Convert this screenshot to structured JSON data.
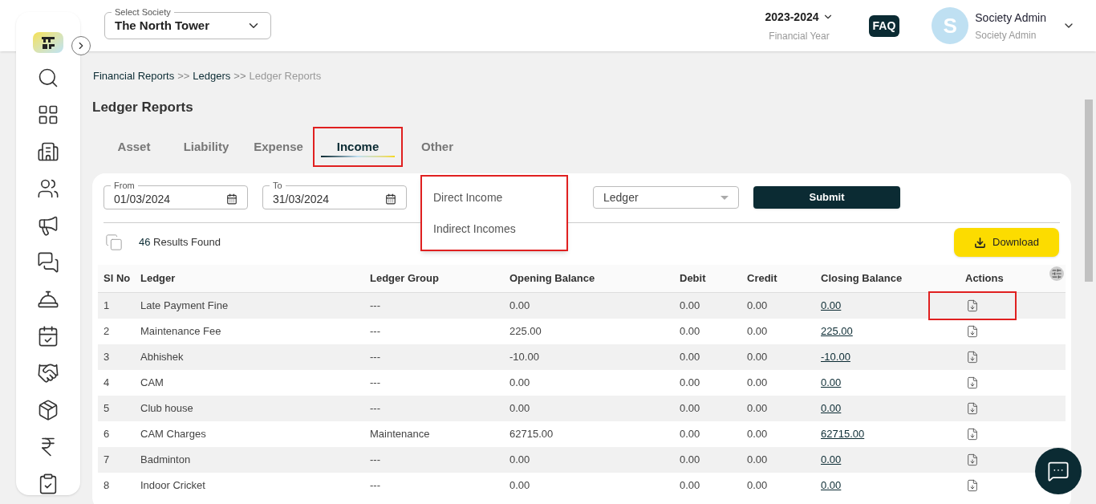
{
  "header": {
    "society_label": "Select Society",
    "society": "The North Tower",
    "year": "2023-2024",
    "year_label": "Financial Year",
    "faq": "FAQ",
    "avatar_letter": "S",
    "user_name": "Society Admin",
    "user_role": "Society Admin"
  },
  "breadcrumb": [
    {
      "label": "Financial Reports",
      "kind": "link"
    },
    {
      "label": ">>",
      "kind": "sep"
    },
    {
      "label": "Ledgers",
      "kind": "link"
    },
    {
      "label": ">>",
      "kind": "sep"
    },
    {
      "label": "Ledger Reports",
      "kind": "current"
    }
  ],
  "title": "Ledger Reports",
  "tabs": [
    {
      "label": "Asset",
      "selected": false,
      "highlighted": false
    },
    {
      "label": "Liability",
      "selected": false,
      "highlighted": false
    },
    {
      "label": "Expense",
      "selected": false,
      "highlighted": false
    },
    {
      "label": "Income",
      "selected": true,
      "highlighted": true
    },
    {
      "label": "Other",
      "selected": false,
      "highlighted": false
    }
  ],
  "filters": {
    "from_label": "From",
    "from": "01/03/2024",
    "to_label": "To",
    "to": "31/03/2024",
    "ledger_placeholder": "Ledger",
    "submit": "Submit"
  },
  "group_menu": {
    "highlighted": true,
    "options": [
      "Direct Income",
      "Indirect Incomes"
    ]
  },
  "results": {
    "count": "46",
    "label": "Results Found",
    "download": "Download"
  },
  "table": {
    "columns": [
      "Sl No",
      "Ledger",
      "Ledger Group",
      "Opening Balance",
      "Debit",
      "Credit",
      "Closing Balance",
      "Actions"
    ],
    "rows": [
      {
        "no": "1",
        "ledger": "Late Payment Fine",
        "group": "---",
        "opening": "0.00",
        "debit": "0.00",
        "credit": "0.00",
        "closing": "0.00",
        "highlighted": true
      },
      {
        "no": "2",
        "ledger": "Maintenance Fee",
        "group": "---",
        "opening": "225.00",
        "debit": "0.00",
        "credit": "0.00",
        "closing": "225.00",
        "highlighted": false
      },
      {
        "no": "3",
        "ledger": "Abhishek",
        "group": "---",
        "opening": "-10.00",
        "debit": "0.00",
        "credit": "0.00",
        "closing": "-10.00",
        "highlighted": false
      },
      {
        "no": "4",
        "ledger": "CAM",
        "group": "---",
        "opening": "0.00",
        "debit": "0.00",
        "credit": "0.00",
        "closing": "0.00",
        "highlighted": false
      },
      {
        "no": "5",
        "ledger": "Club house",
        "group": "---",
        "opening": "0.00",
        "debit": "0.00",
        "credit": "0.00",
        "closing": "0.00",
        "highlighted": false
      },
      {
        "no": "6",
        "ledger": "CAM Charges",
        "group": "Maintenance",
        "opening": "62715.00",
        "debit": "0.00",
        "credit": "0.00",
        "closing": "62715.00",
        "highlighted": false
      },
      {
        "no": "7",
        "ledger": "Badminton",
        "group": "---",
        "opening": "0.00",
        "debit": "0.00",
        "credit": "0.00",
        "closing": "0.00",
        "highlighted": false
      },
      {
        "no": "8",
        "ledger": "Indoor Cricket",
        "group": "---",
        "opening": "0.00",
        "debit": "0.00",
        "credit": "0.00",
        "closing": "0.00",
        "highlighted": false
      }
    ]
  }
}
